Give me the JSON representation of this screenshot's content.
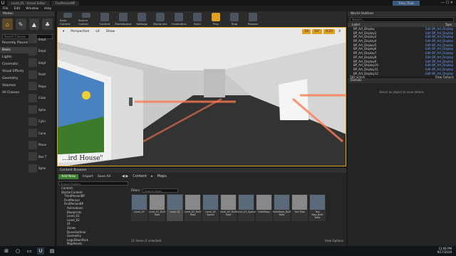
{
  "titlebar": {
    "tabs": [
      "Level_01 · Unreal Editor",
      "FirstPersonMP"
    ],
    "right_title": "Time_Trials"
  },
  "menubar": [
    "File",
    "Edit",
    "Window",
    "Help"
  ],
  "modes": {
    "title": "Modes",
    "search_placeholder": "Search Classes",
    "categories": [
      "Recently Placed",
      "Basic",
      "Lights",
      "Cinematic",
      "Visual Effects",
      "Geometry",
      "Volumes",
      "All Classes"
    ],
    "selected_category": "Basic",
    "items": [
      "Empt",
      "Empt",
      "Empt",
      "Point",
      "Playe",
      "Cube",
      "Sphe",
      "Cylin",
      "Cone",
      "Plane",
      "Box T",
      "Sphe"
    ]
  },
  "toolbar": {
    "buttons": [
      "Save Current",
      "Source Control",
      "Content",
      "Marketplace",
      "Settings",
      "Blueprints",
      "Cinematics",
      "Build",
      "Play",
      "Stop",
      "Possess"
    ]
  },
  "viewport": {
    "buttons": [
      "Perspective",
      "Lit",
      "Show"
    ],
    "snap_values": [
      "10",
      "10°",
      "0.25",
      "4"
    ],
    "painting_caption": "...ird House\""
  },
  "outliner": {
    "title": "World Outliner",
    "search_placeholder": "Search...",
    "col_label": "Label",
    "col_type": "Type",
    "rows": [
      {
        "label": "BP_Art_Display",
        "type": "Edit BP_Art_Display"
      },
      {
        "label": "BP_Art_Display2",
        "type": "Edit BP_Art_Display"
      },
      {
        "label": "BP_Art_Display3",
        "type": "Edit BP_Art_Display"
      },
      {
        "label": "BP_Art_Display4",
        "type": "Edit BP_Art_Display"
      },
      {
        "label": "BP_Art_Display5",
        "type": "Edit BP_Art_Display"
      },
      {
        "label": "BP_Art_Display6",
        "type": "Edit BP_Art_Display"
      },
      {
        "label": "BP_Art_Display7",
        "type": "Edit BP_Art_Display"
      },
      {
        "label": "BP_Art_Display8",
        "type": "Edit BP_Art_Display"
      },
      {
        "label": "BP_Art_Display9",
        "type": "Edit BP_Art_Display"
      },
      {
        "label": "BP_Art_Display10",
        "type": "Edit BP_Art_Display"
      },
      {
        "label": "BP_Art_Display11",
        "type": "Edit BP_Art_Display"
      },
      {
        "label": "BP_Art_Display12",
        "type": "Edit BP_Art_Display"
      }
    ],
    "footer_count": "582 actors",
    "view_options": "View Options"
  },
  "details": {
    "title": "Details",
    "empty_text": "Select an object to view details."
  },
  "content_browser": {
    "title": "Content Browser",
    "add_new": "Add New",
    "import": "Import",
    "save_all": "Save All",
    "breadcrumb": [
      "Content",
      "Maps"
    ],
    "search_folders": "Search Folders",
    "filters": "Filters",
    "search_assets": "Search Maps",
    "tree": [
      "Content",
      "StarterContent",
      "ThirdPersonBP",
      "FirstPerson",
      "FirstPersonBP",
      "Animations",
      "Blueprints",
      "Level_01",
      "Level_02",
      "UI",
      "Zones",
      "DuneOutliner",
      "Geometry",
      "LogoDownPack",
      "MapAssets",
      "Maps"
    ],
    "tree_selected": "Maps",
    "assets": [
      "Level_01",
      "Level_01_Built Data",
      "Level_01",
      "Level_02_Built Data",
      "Level_02 Spawn",
      "Level_02_Built Data",
      "Level_03_Spawn",
      "HallsMaps",
      "HallsMaps_Built Data",
      "Test Map",
      "Test Map_Built Data"
    ],
    "selected_asset": "Level_01",
    "footer": "11 items (1 selected)",
    "view_options": "View Options"
  },
  "taskbar": {
    "time": "12:06 PM",
    "date": "9/17/2019"
  }
}
